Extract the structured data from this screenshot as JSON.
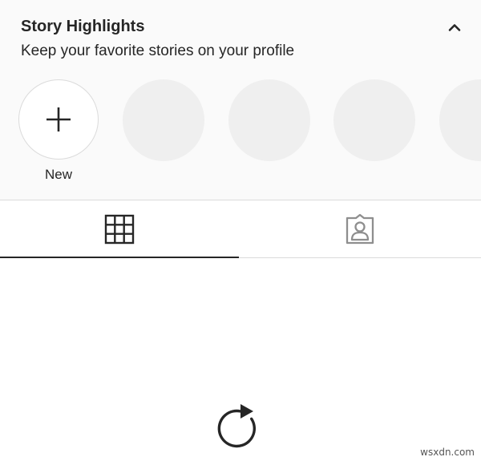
{
  "highlights": {
    "title": "Story Highlights",
    "subtitle": "Keep your favorite stories on your profile",
    "collapse_icon": "chevron-up-icon",
    "new_label": "New",
    "new_icon": "plus-icon",
    "placeholder_count": 4
  },
  "tabs": [
    {
      "name": "posts-grid",
      "icon": "grid-icon",
      "active": true
    },
    {
      "name": "tagged",
      "icon": "tagged-user-icon",
      "active": false
    }
  ],
  "content": {
    "loading_icon": "refresh-icon"
  },
  "watermark": "wsxdn.com",
  "colors": {
    "text": "#262626",
    "highlights_bg": "#fafafa",
    "placeholder": "#efefef",
    "border": "#dbdbdb",
    "inactive_icon": "#8e8e8e"
  }
}
